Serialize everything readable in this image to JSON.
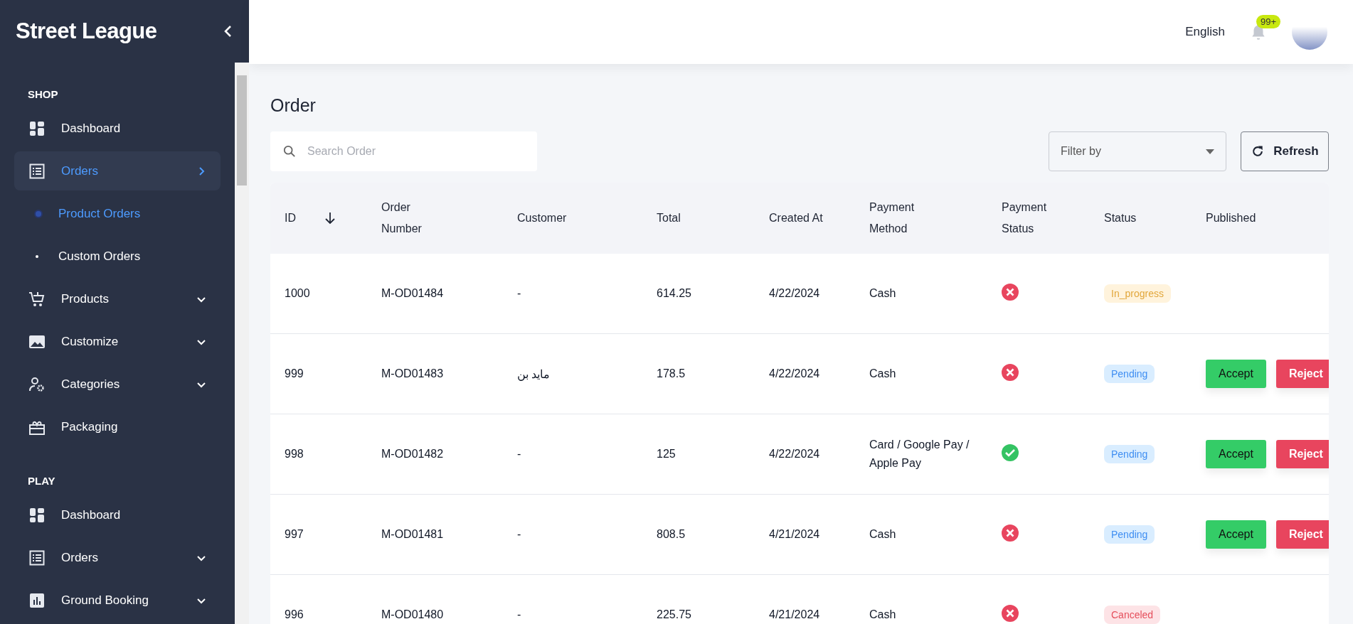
{
  "sidebar": {
    "logo": "Street League",
    "sections": [
      {
        "title": "SHOP",
        "items": [
          {
            "label": "Dashboard",
            "kind": "link",
            "selected": false
          },
          {
            "label": "Orders",
            "kind": "group",
            "selected": true,
            "expanded": true,
            "children": [
              {
                "label": "Product Orders",
                "selected": true
              },
              {
                "label": "Custom Orders",
                "selected": false
              }
            ]
          },
          {
            "label": "Products",
            "kind": "group",
            "selected": false,
            "expanded": false
          },
          {
            "label": "Customize",
            "kind": "group",
            "selected": false,
            "expanded": false
          },
          {
            "label": "Categories",
            "kind": "group",
            "selected": false,
            "expanded": false
          },
          {
            "label": "Packaging",
            "kind": "link",
            "selected": false
          }
        ]
      },
      {
        "title": "PLAY",
        "items": [
          {
            "label": "Dashboard",
            "kind": "link",
            "selected": false
          },
          {
            "label": "Orders",
            "kind": "group",
            "selected": false,
            "expanded": false
          },
          {
            "label": "Ground Booking",
            "kind": "group",
            "selected": false,
            "expanded": false
          }
        ]
      }
    ]
  },
  "header": {
    "language": "English",
    "notifications": "99+"
  },
  "page": {
    "title": "Order",
    "search": {
      "placeholder": "Search Order"
    },
    "filter": {
      "placeholder": "Filter by"
    },
    "refresh": "Refresh"
  },
  "table": {
    "columns": [
      "ID",
      "Order Number",
      "Customer",
      "Total",
      "Created At",
      "Payment Method",
      "Payment Status",
      "Status",
      "Published"
    ],
    "rows": [
      {
        "id": "1000",
        "order_number": "M-OD01484",
        "customer": "-",
        "total": "614.25",
        "created_at": "4/22/2024",
        "payment_method": "Cash",
        "paid": false,
        "status": {
          "label": "In_progress",
          "kind": "in_progress"
        },
        "actions": []
      },
      {
        "id": "999",
        "order_number": "M-OD01483",
        "customer": "مايد بن",
        "total": "178.5",
        "created_at": "4/22/2024",
        "payment_method": "Cash",
        "paid": false,
        "status": {
          "label": "Pending",
          "kind": "pending"
        },
        "actions": [
          {
            "label": "Accept",
            "kind": "accept"
          },
          {
            "label": "Reject",
            "kind": "reject"
          }
        ]
      },
      {
        "id": "998",
        "order_number": "M-OD01482",
        "customer": "-",
        "total": "125",
        "created_at": "4/22/2024",
        "payment_method": "Card / Google Pay / Apple Pay",
        "paid": true,
        "status": {
          "label": "Pending",
          "kind": "pending"
        },
        "actions": [
          {
            "label": "Accept",
            "kind": "accept"
          },
          {
            "label": "Reject",
            "kind": "reject"
          }
        ]
      },
      {
        "id": "997",
        "order_number": "M-OD01481",
        "customer": "-",
        "total": "808.5",
        "created_at": "4/21/2024",
        "payment_method": "Cash",
        "paid": false,
        "status": {
          "label": "Pending",
          "kind": "pending"
        },
        "actions": [
          {
            "label": "Accept",
            "kind": "accept"
          },
          {
            "label": "Reject",
            "kind": "reject"
          }
        ]
      },
      {
        "id": "996",
        "order_number": "M-OD01480",
        "customer": "-",
        "total": "225.75",
        "created_at": "4/21/2024",
        "payment_method": "Cash",
        "paid": false,
        "status": {
          "label": "Canceled",
          "kind": "canceled"
        },
        "actions": []
      }
    ]
  }
}
